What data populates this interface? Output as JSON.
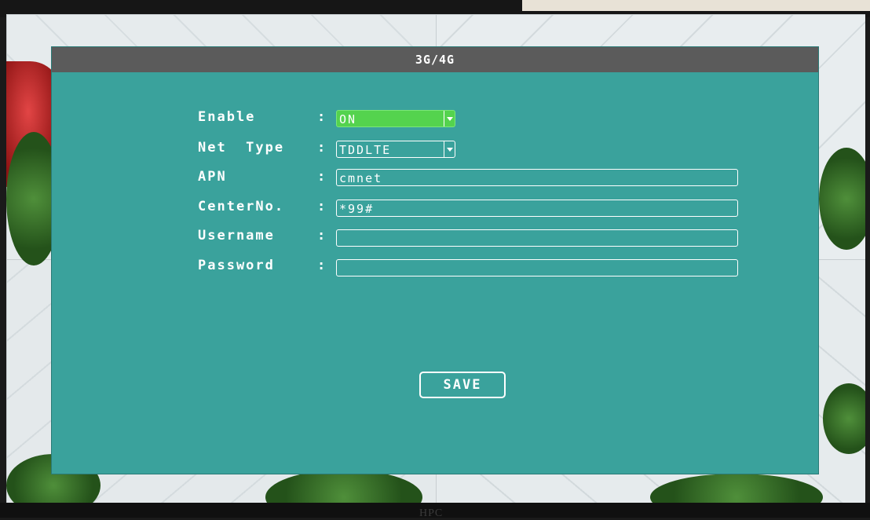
{
  "monitor": {
    "brand": "HPC"
  },
  "dialog": {
    "title": "3G/4G",
    "fields": [
      {
        "label": "Enable",
        "colon": ":",
        "value": "ON",
        "type": "select",
        "highlight": "#54d34e"
      },
      {
        "label": "Net  Type",
        "colon": ":",
        "value": "TDDLTE",
        "type": "select"
      },
      {
        "label": "APN",
        "colon": ":",
        "value": "cmnet",
        "type": "text"
      },
      {
        "label": "CenterNo.",
        "colon": ":",
        "value": "*99#",
        "type": "text"
      },
      {
        "label": "Username",
        "colon": ":",
        "value": "",
        "type": "text"
      },
      {
        "label": "Password",
        "colon": ":",
        "value": "",
        "type": "text"
      }
    ],
    "save_label": "SAVE"
  },
  "colors": {
    "dialog_bg": "#3aa29c",
    "title_bar": "#5b5b5b",
    "selected_option": "#54d34e"
  },
  "icons": [
    "dropdown-arrow-icon"
  ]
}
